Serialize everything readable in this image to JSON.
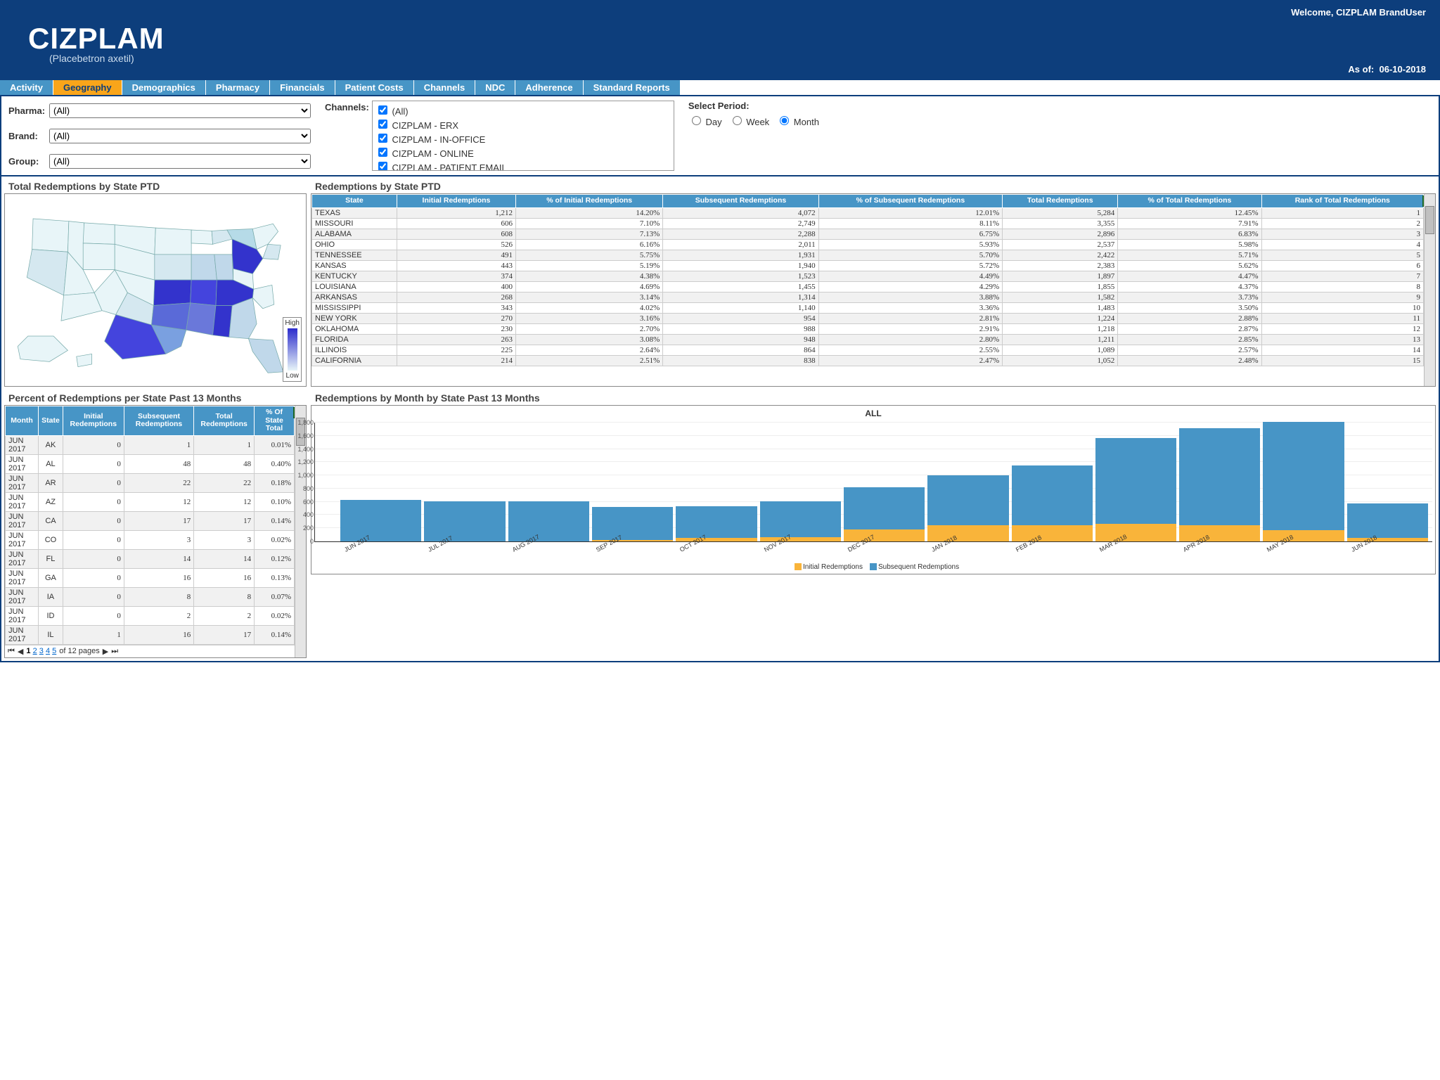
{
  "header": {
    "welcome": "Welcome, CIZPLAM BrandUser",
    "brand": "CIZPLAM",
    "brand_sub": "(Placebetron axetil)",
    "asof_label": "As of:",
    "asof_value": "06-10-2018"
  },
  "tabs": [
    "Activity",
    "Geography",
    "Demographics",
    "Pharmacy",
    "Financials",
    "Patient Costs",
    "Channels",
    "NDC",
    "Adherence",
    "Standard Reports"
  ],
  "active_tab": 1,
  "filters": {
    "pharma_label": "Pharma:",
    "pharma_value": "(All)",
    "brand_label": "Brand:",
    "brand_value": "(All)",
    "group_label": "Group:",
    "group_value": "(All)",
    "channels_label": "Channels:",
    "channels": [
      "(All)",
      "CIZPLAM - ERX",
      "CIZPLAM - IN-OFFICE",
      "CIZPLAM - ONLINE",
      "CIZPLAM - PATIENT EMAIL"
    ],
    "period_label": "Select Period:",
    "period_options": [
      "Day",
      "Week",
      "Month"
    ],
    "period_selected": "Month"
  },
  "panels": {
    "map_title": "Total Redemptions by State PTD",
    "legend_high": "High",
    "legend_low": "Low",
    "state_table_title": "Redemptions by State PTD",
    "state_cols": [
      "State",
      "Initial Redemptions",
      "% of Initial Redemptions",
      "Subsequent Redemptions",
      "% of Subsequent Redemptions",
      "Total Redemptions",
      "% of Total Redemptions",
      "Rank of Total Redemptions"
    ],
    "state_rows": [
      [
        "TEXAS",
        "1,212",
        "14.20%",
        "4,072",
        "12.01%",
        "5,284",
        "12.45%",
        "1"
      ],
      [
        "MISSOURI",
        "606",
        "7.10%",
        "2,749",
        "8.11%",
        "3,355",
        "7.91%",
        "2"
      ],
      [
        "ALABAMA",
        "608",
        "7.13%",
        "2,288",
        "6.75%",
        "2,896",
        "6.83%",
        "3"
      ],
      [
        "OHIO",
        "526",
        "6.16%",
        "2,011",
        "5.93%",
        "2,537",
        "5.98%",
        "4"
      ],
      [
        "TENNESSEE",
        "491",
        "5.75%",
        "1,931",
        "5.70%",
        "2,422",
        "5.71%",
        "5"
      ],
      [
        "KANSAS",
        "443",
        "5.19%",
        "1,940",
        "5.72%",
        "2,383",
        "5.62%",
        "6"
      ],
      [
        "KENTUCKY",
        "374",
        "4.38%",
        "1,523",
        "4.49%",
        "1,897",
        "4.47%",
        "7"
      ],
      [
        "LOUISIANA",
        "400",
        "4.69%",
        "1,455",
        "4.29%",
        "1,855",
        "4.37%",
        "8"
      ],
      [
        "ARKANSAS",
        "268",
        "3.14%",
        "1,314",
        "3.88%",
        "1,582",
        "3.73%",
        "9"
      ],
      [
        "MISSISSIPPI",
        "343",
        "4.02%",
        "1,140",
        "3.36%",
        "1,483",
        "3.50%",
        "10"
      ],
      [
        "NEW YORK",
        "270",
        "3.16%",
        "954",
        "2.81%",
        "1,224",
        "2.88%",
        "11"
      ],
      [
        "OKLAHOMA",
        "230",
        "2.70%",
        "988",
        "2.91%",
        "1,218",
        "2.87%",
        "12"
      ],
      [
        "FLORIDA",
        "263",
        "3.08%",
        "948",
        "2.80%",
        "1,211",
        "2.85%",
        "13"
      ],
      [
        "ILLINOIS",
        "225",
        "2.64%",
        "864",
        "2.55%",
        "1,089",
        "2.57%",
        "14"
      ],
      [
        "CALIFORNIA",
        "214",
        "2.51%",
        "838",
        "2.47%",
        "1,052",
        "2.48%",
        "15"
      ]
    ],
    "pct_title": "Percent of Redemptions per State Past 13 Months",
    "pct_cols": [
      "Month",
      "State",
      "Initial Redemptions",
      "Subsequent Redemptions",
      "Total Redemptions",
      "% Of State Total"
    ],
    "pct_rows": [
      [
        "JUN 2017",
        "AK",
        "0",
        "1",
        "1",
        "0.01%"
      ],
      [
        "JUN 2017",
        "AL",
        "0",
        "48",
        "48",
        "0.40%"
      ],
      [
        "JUN 2017",
        "AR",
        "0",
        "22",
        "22",
        "0.18%"
      ],
      [
        "JUN 2017",
        "AZ",
        "0",
        "12",
        "12",
        "0.10%"
      ],
      [
        "JUN 2017",
        "CA",
        "0",
        "17",
        "17",
        "0.14%"
      ],
      [
        "JUN 2017",
        "CO",
        "0",
        "3",
        "3",
        "0.02%"
      ],
      [
        "JUN 2017",
        "FL",
        "0",
        "14",
        "14",
        "0.12%"
      ],
      [
        "JUN 2017",
        "GA",
        "0",
        "16",
        "16",
        "0.13%"
      ],
      [
        "JUN 2017",
        "IA",
        "0",
        "8",
        "8",
        "0.07%"
      ],
      [
        "JUN 2017",
        "ID",
        "0",
        "2",
        "2",
        "0.02%"
      ],
      [
        "JUN 2017",
        "IL",
        "1",
        "16",
        "17",
        "0.14%"
      ]
    ],
    "pager": {
      "pages": [
        "1",
        "2",
        "3",
        "4",
        "5"
      ],
      "current": "1",
      "of_label": "of 12 pages"
    },
    "mchart_title": "Redemptions by Month by State Past 13 Months"
  },
  "chart_data": {
    "type": "bar",
    "title": "ALL",
    "categories": [
      "JUN 2017",
      "JUL 2017",
      "AUG 2017",
      "SEP 2017",
      "OCT 2017",
      "NOV 2017",
      "DEC 2017",
      "JAN 2018",
      "FEB 2018",
      "MAR 2018",
      "APR 2018",
      "MAY 2018",
      "JUN 2018"
    ],
    "series": [
      {
        "name": "Initial Redemptions",
        "color": "#f9b43a",
        "values": [
          0,
          0,
          0,
          20,
          50,
          60,
          180,
          240,
          240,
          260,
          240,
          170,
          50
        ]
      },
      {
        "name": "Subsequent Redemptions",
        "color": "#4795c6",
        "values": [
          620,
          600,
          600,
          500,
          480,
          540,
          640,
          760,
          900,
          1300,
          1460,
          1630,
          520
        ]
      }
    ],
    "ylabel": "",
    "xlabel": "",
    "ylim": [
      0,
      1800
    ],
    "yticks": [
      0,
      200,
      400,
      600,
      800,
      1000,
      1200,
      1400,
      1600,
      1800
    ]
  }
}
